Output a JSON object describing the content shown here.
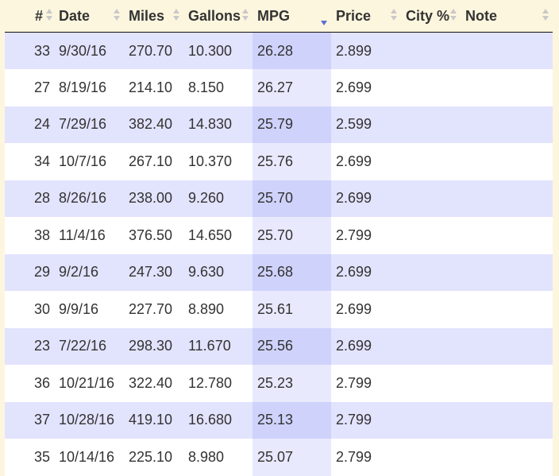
{
  "table": {
    "columns": [
      {
        "key": "num",
        "label": "#"
      },
      {
        "key": "date",
        "label": "Date"
      },
      {
        "key": "miles",
        "label": "Miles"
      },
      {
        "key": "gallons",
        "label": "Gallons"
      },
      {
        "key": "mpg",
        "label": "MPG"
      },
      {
        "key": "price",
        "label": "Price"
      },
      {
        "key": "city",
        "label": "City %"
      },
      {
        "key": "note",
        "label": "Note"
      }
    ],
    "sorted_column": "MPG",
    "sort_direction": "descending",
    "rows": [
      {
        "num": "33",
        "date": "9/30/16",
        "miles": "270.70",
        "gallons": "10.300",
        "mpg": "26.28",
        "price": "2.899",
        "city": "",
        "note": ""
      },
      {
        "num": "27",
        "date": "8/19/16",
        "miles": "214.10",
        "gallons": "8.150",
        "mpg": "26.27",
        "price": "2.699",
        "city": "",
        "note": ""
      },
      {
        "num": "24",
        "date": "7/29/16",
        "miles": "382.40",
        "gallons": "14.830",
        "mpg": "25.79",
        "price": "2.599",
        "city": "",
        "note": ""
      },
      {
        "num": "34",
        "date": "10/7/16",
        "miles": "267.10",
        "gallons": "10.370",
        "mpg": "25.76",
        "price": "2.699",
        "city": "",
        "note": ""
      },
      {
        "num": "28",
        "date": "8/26/16",
        "miles": "238.00",
        "gallons": "9.260",
        "mpg": "25.70",
        "price": "2.699",
        "city": "",
        "note": ""
      },
      {
        "num": "38",
        "date": "11/4/16",
        "miles": "376.50",
        "gallons": "14.650",
        "mpg": "25.70",
        "price": "2.799",
        "city": "",
        "note": ""
      },
      {
        "num": "29",
        "date": "9/2/16",
        "miles": "247.30",
        "gallons": "9.630",
        "mpg": "25.68",
        "price": "2.699",
        "city": "",
        "note": ""
      },
      {
        "num": "30",
        "date": "9/9/16",
        "miles": "227.70",
        "gallons": "8.890",
        "mpg": "25.61",
        "price": "2.699",
        "city": "",
        "note": ""
      },
      {
        "num": "23",
        "date": "7/22/16",
        "miles": "298.30",
        "gallons": "11.670",
        "mpg": "25.56",
        "price": "2.699",
        "city": "",
        "note": ""
      },
      {
        "num": "36",
        "date": "10/21/16",
        "miles": "322.40",
        "gallons": "12.780",
        "mpg": "25.23",
        "price": "2.799",
        "city": "",
        "note": ""
      },
      {
        "num": "37",
        "date": "10/28/16",
        "miles": "419.10",
        "gallons": "16.680",
        "mpg": "25.13",
        "price": "2.799",
        "city": "",
        "note": ""
      },
      {
        "num": "35",
        "date": "10/14/16",
        "miles": "225.10",
        "gallons": "8.980",
        "mpg": "25.07",
        "price": "2.799",
        "city": "",
        "note": ""
      }
    ]
  },
  "colors": {
    "page_background": "#fdf6de",
    "row_odd": "#e2e3fd",
    "row_even": "#ffffff",
    "sorted_column_odd": "#cfd2fa",
    "sorted_column_even": "#e8e9fd",
    "sort_icon_active": "#5a6fd6",
    "sort_icon_inactive": "#c9c9c9"
  },
  "icons": {
    "sort": "sort-both-icon",
    "sort_active": "sort-descending-icon"
  }
}
